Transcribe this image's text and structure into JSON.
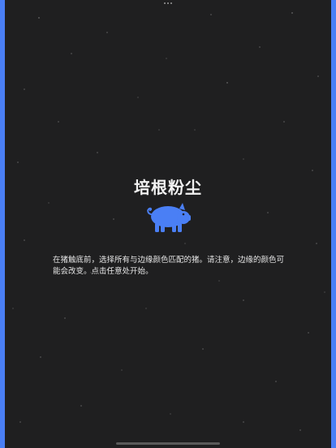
{
  "game": {
    "title": "培根粉尘",
    "instructions": "在猪触底前，选择所有与边缘颜色匹配的猪。请注意，边缘的颜色可能会改变。点击任意处开始。",
    "pig_icon": "pig-icon",
    "border_color": "#4a7ff5",
    "pig_color": "#4a7ff5",
    "background_color": "#1f1f20"
  }
}
